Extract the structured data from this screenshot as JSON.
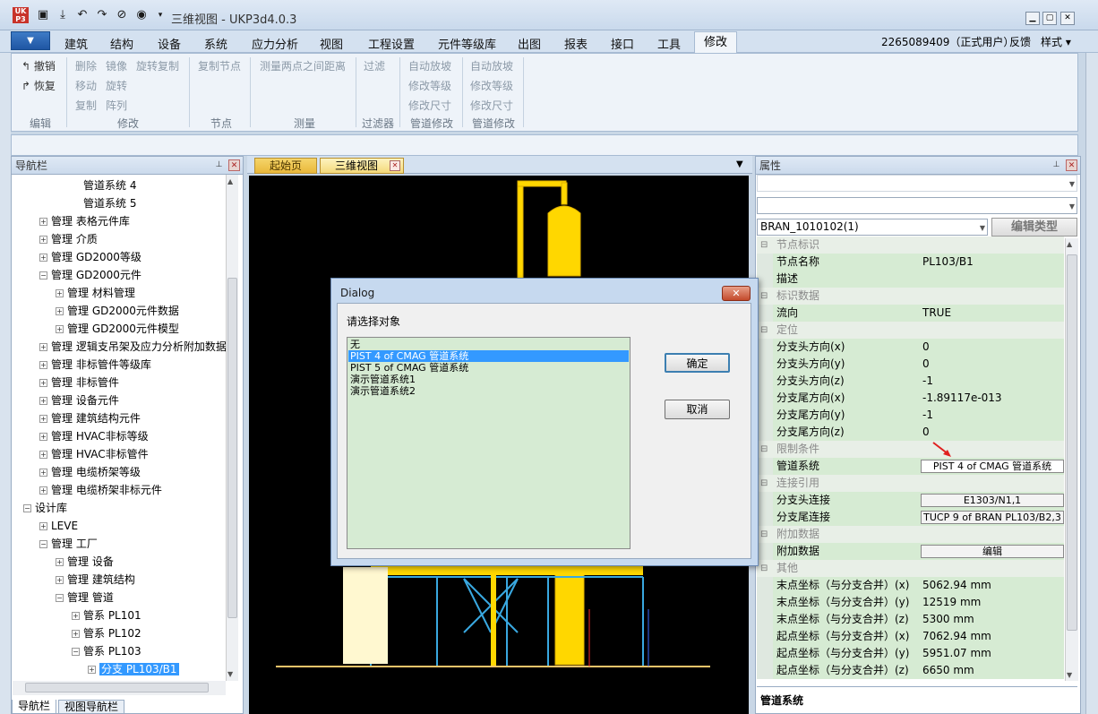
{
  "app": {
    "title": "三维视图 - UKP3d4.0.3"
  },
  "menu": {
    "tabs": [
      "建筑",
      "结构",
      "设备",
      "系统",
      "应力分析",
      "视图",
      "工程设置",
      "元件等级库",
      "出图",
      "报表",
      "接口",
      "工具"
    ],
    "active_tab": "修改",
    "user": "2265089409（正式用户）",
    "feedback": "反馈",
    "style": "样式"
  },
  "ribbon": {
    "edit": {
      "undo": "撤销",
      "redo": "恢复",
      "label": "编辑"
    },
    "modify": {
      "delete": "删除",
      "mirror": "镜像",
      "rotate_copy": "旋转复制",
      "move": "移动",
      "rotate": "旋转",
      "copy": "复制",
      "array": "阵列",
      "label": "修改"
    },
    "node": {
      "copy_node": "复制节点",
      "label": "节点"
    },
    "measure": {
      "measure_dist": "测量两点之间距离",
      "label": "测量"
    },
    "filter": {
      "filter": "过滤",
      "label": "过滤器"
    },
    "pipe_modify1": {
      "auto_slope": "自动放坡",
      "mod_grade": "修改等级",
      "mod_size": "修改尺寸",
      "label": "管道修改"
    },
    "pipe_modify2": {
      "auto_slope": "自动放坡",
      "mod_grade": "修改等级",
      "mod_size": "修改尺寸",
      "label": "管道修改"
    }
  },
  "nav": {
    "title": "导航栏",
    "items": [
      {
        "text": "管道系统 4",
        "indent": 4,
        "box": ""
      },
      {
        "text": "管道系统 5",
        "indent": 4,
        "box": ""
      },
      {
        "text": "管理 表格元件库",
        "indent": 2,
        "box": "+"
      },
      {
        "text": "管理 介质",
        "indent": 2,
        "box": "+"
      },
      {
        "text": "管理 GD2000等级",
        "indent": 2,
        "box": "+"
      },
      {
        "text": "管理 GD2000元件",
        "indent": 2,
        "box": "−"
      },
      {
        "text": "管理 材料管理",
        "indent": 3,
        "box": "+"
      },
      {
        "text": "管理 GD2000元件数据",
        "indent": 3,
        "box": "+"
      },
      {
        "text": "管理 GD2000元件模型",
        "indent": 3,
        "box": "+"
      },
      {
        "text": "管理 逻辑支吊架及应力分析附加数据",
        "indent": 2,
        "box": "+"
      },
      {
        "text": "管理 非标管件等级库",
        "indent": 2,
        "box": "+"
      },
      {
        "text": "管理 非标管件",
        "indent": 2,
        "box": "+"
      },
      {
        "text": "管理 设备元件",
        "indent": 2,
        "box": "+"
      },
      {
        "text": "管理 建筑结构元件",
        "indent": 2,
        "box": "+"
      },
      {
        "text": "管理 HVAC非标等级",
        "indent": 2,
        "box": "+"
      },
      {
        "text": "管理 HVAC非标管件",
        "indent": 2,
        "box": "+"
      },
      {
        "text": "管理 电缆桥架等级",
        "indent": 2,
        "box": "+"
      },
      {
        "text": "管理 电缆桥架非标元件",
        "indent": 2,
        "box": "+"
      },
      {
        "text": "设计库",
        "indent": 1,
        "box": "−"
      },
      {
        "text": "LEVE",
        "indent": 2,
        "box": "+"
      },
      {
        "text": "管理 工厂",
        "indent": 2,
        "box": "−"
      },
      {
        "text": "管理 设备",
        "indent": 3,
        "box": "+"
      },
      {
        "text": "管理 建筑结构",
        "indent": 3,
        "box": "+"
      },
      {
        "text": "管理 管道",
        "indent": 3,
        "box": "−"
      },
      {
        "text": "管系 PL101",
        "indent": 4,
        "box": "+"
      },
      {
        "text": "管系 PL102",
        "indent": 4,
        "box": "+"
      },
      {
        "text": "管系 PL103",
        "indent": 4,
        "box": "−"
      },
      {
        "text": "分支 PL103/B1",
        "indent": 5,
        "box": "+",
        "selected": true
      }
    ],
    "bottom_tabs": [
      "导航栏",
      "视图导航栏"
    ]
  },
  "doc": {
    "tabs": [
      "起始页",
      "三维视图"
    ]
  },
  "props": {
    "title": "属性",
    "selector": "BRAN_1010102(1)",
    "edit_type_btn": "编辑类型",
    "rows": [
      {
        "type": "sec",
        "k": "节点标识"
      },
      {
        "type": "field",
        "k": "节点名称",
        "v": "PL103/B1"
      },
      {
        "type": "field",
        "k": "描述",
        "v": ""
      },
      {
        "type": "sec",
        "k": "标识数据"
      },
      {
        "type": "field",
        "k": "流向",
        "v": "TRUE"
      },
      {
        "type": "sec",
        "k": "定位"
      },
      {
        "type": "field",
        "k": "分支头方向(x)",
        "v": "0"
      },
      {
        "type": "field",
        "k": "分支头方向(y)",
        "v": "0"
      },
      {
        "type": "field",
        "k": "分支头方向(z)",
        "v": "-1"
      },
      {
        "type": "field",
        "k": "分支尾方向(x)",
        "v": "-1.89117e-013"
      },
      {
        "type": "field",
        "k": "分支尾方向(y)",
        "v": "-1"
      },
      {
        "type": "field",
        "k": "分支尾方向(z)",
        "v": "0"
      },
      {
        "type": "sec",
        "k": "限制条件"
      },
      {
        "type": "btn",
        "k": "管道系统",
        "v": "PIST 4 of CMAG 管道系统",
        "white": true
      },
      {
        "type": "sec",
        "k": "连接引用"
      },
      {
        "type": "btn",
        "k": "分支头连接",
        "v": "E1303/N1,1"
      },
      {
        "type": "btn",
        "k": "分支尾连接",
        "v": "TUCP 9 of BRAN PL103/B2,3"
      },
      {
        "type": "sec",
        "k": "附加数据"
      },
      {
        "type": "btn",
        "k": "附加数据",
        "v": "编辑"
      },
      {
        "type": "sec",
        "k": "其他"
      },
      {
        "type": "field",
        "k": "末点坐标（与分支合并）(x)",
        "v": "5062.94 mm"
      },
      {
        "type": "field",
        "k": "末点坐标（与分支合并）(y)",
        "v": "12519 mm"
      },
      {
        "type": "field",
        "k": "末点坐标（与分支合并）(z)",
        "v": "5300 mm"
      },
      {
        "type": "field",
        "k": "起点坐标（与分支合并）(x)",
        "v": "7062.94 mm"
      },
      {
        "type": "field",
        "k": "起点坐标（与分支合并）(y)",
        "v": "5951.07 mm"
      },
      {
        "type": "field",
        "k": "起点坐标（与分支合并）(z)",
        "v": "6650 mm"
      }
    ],
    "desc": "管道系统"
  },
  "dialog": {
    "title": "Dialog",
    "prompt": "请选择对象",
    "items": [
      "无",
      "PIST 4 of CMAG 管道系统",
      "PIST 5 of CMAG 管道系统",
      "演示管道系统1",
      "演示管道系统2"
    ],
    "selected_index": 1,
    "ok": "确定",
    "cancel": "取消"
  },
  "colors": {
    "ribbon_bg": "#eef3f9",
    "prop_field": "#d6ebd3",
    "selection": "#3399ff",
    "pipe_yellow": "#ffd700",
    "pipe_blue": "#39a8e0"
  }
}
